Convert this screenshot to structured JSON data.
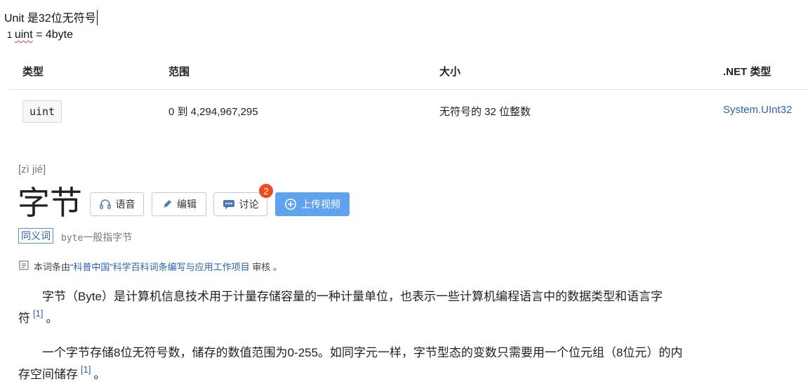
{
  "notes": {
    "line1": "Unit 是32位无符号",
    "line2_prefix": "1 ",
    "line2_word": "uint",
    "line2_suffix": " = 4byte"
  },
  "table": {
    "headers": [
      "类型",
      "范围",
      "大小",
      ".NET 类型"
    ],
    "row": {
      "type": "uint",
      "range": "0 到 4,294,967,295",
      "size": "无符号的 32 位整数",
      "dotnet": "System.UInt32"
    }
  },
  "entry": {
    "pinyin": "[zì jié]",
    "word": "字节",
    "buttons": {
      "audio": "语音",
      "edit": "编辑",
      "discuss": "讨论",
      "discuss_badge": "2",
      "upload": "上传视频"
    },
    "synonym_tag": "同义词",
    "synonym_code": "byte",
    "synonym_text": "一般指字节",
    "source_prefix": "本词条由",
    "source_link": "“科普中国”科学百科词条编写与应用工作项目",
    "source_suffix": " 审核 。",
    "paragraphs": [
      {
        "text": "字节（Byte）是计算机信息技术用于计量存储容量的一种计量单位，也表示一些计算机编程语言中的数据类型和语言字",
        "tail": "符",
        "ref": "[1]",
        "end": "。"
      },
      {
        "text": "一个字节存储8位无符号数，储存的数值范围为0-255。如同字元一样，字节型态的变数只需要用一个位元组（8位元）的内",
        "tail": "存空间储存",
        "ref": "[1]",
        "end": "。"
      }
    ]
  },
  "colors": {
    "link": "#2a62b0",
    "upload_button": "#5fa2ee",
    "badge": "#ee4a1f"
  },
  "icons": [
    "headphones-icon",
    "pencil-icon",
    "chat-icon",
    "plus-circle-icon",
    "document-icon"
  ]
}
